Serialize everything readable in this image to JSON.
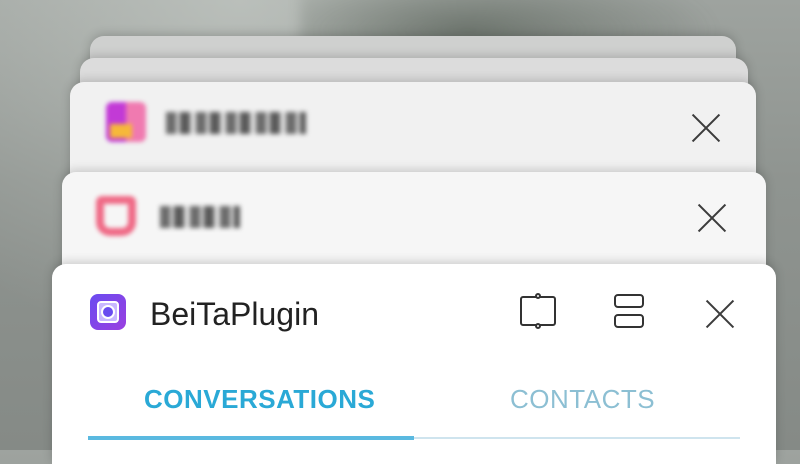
{
  "recents": {
    "cards": [
      {
        "id": "blurred-app-1",
        "title_obscured": true
      },
      {
        "id": "blurred-app-2",
        "title_obscured": true
      }
    ],
    "active_card": {
      "app_title": "BeiTaPlugin",
      "tabs": [
        {
          "label": "CONVERSATIONS",
          "selected": true
        },
        {
          "label": "CONTACTS",
          "selected": false
        }
      ]
    }
  },
  "colors": {
    "accent": "#2aa9d6",
    "inactive_tab": "#8cbfd3",
    "card_bg": "#ffffff"
  },
  "icons": {
    "close": "close-icon",
    "floating_window": "floating-window-icon",
    "split_screen": "split-screen-icon",
    "app": "beitaplugin-app-icon"
  }
}
